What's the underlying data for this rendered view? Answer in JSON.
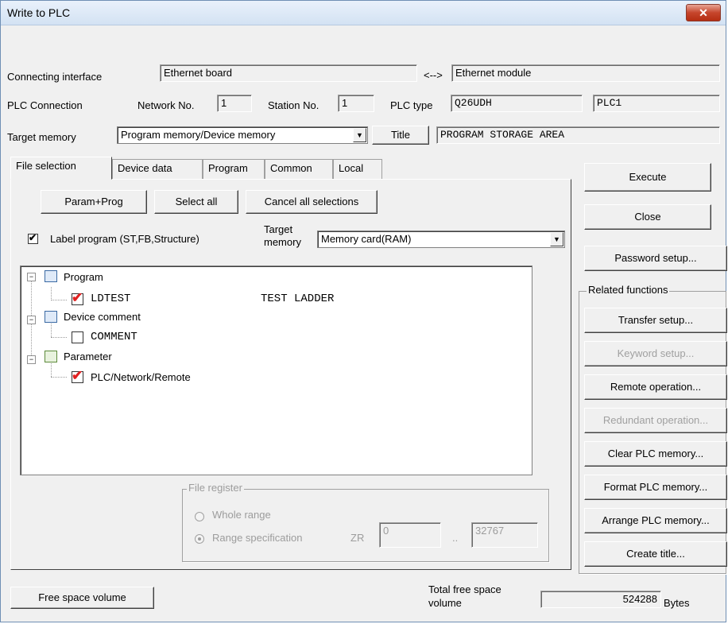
{
  "window": {
    "title": "Write to PLC",
    "close_label": "✕"
  },
  "connection": {
    "interface_label": "Connecting interface",
    "interface_value": "Ethernet board",
    "arrow": "<-->",
    "module_value": "Ethernet module",
    "plc_connection_label": "PLC Connection",
    "network_label": "Network No.",
    "network_value": "1",
    "station_label": "Station No.",
    "station_value": "1",
    "plc_type_label": "PLC type",
    "plc_type_value": "Q26UDH",
    "plc_name_value": "PLC1"
  },
  "target": {
    "label": "Target memory",
    "value": "Program memory/Device memory",
    "title_button": "Title",
    "title_value": "PROGRAM STORAGE AREA"
  },
  "tabs": [
    {
      "label": "File selection"
    },
    {
      "label": "Device data"
    },
    {
      "label": "Program"
    },
    {
      "label": "Common"
    },
    {
      "label": "Local"
    }
  ],
  "file_selection": {
    "param_prog": "Param+Prog",
    "select_all": "Select all",
    "cancel_all": "Cancel all selections",
    "label_program": "Label program (ST,FB,Structure)",
    "target_memory_label_1": "Target",
    "target_memory_label_2": "memory",
    "target_memory_value": "Memory card(RAM)",
    "tree": {
      "program": "Program",
      "ldtest": "LDTEST",
      "ldtest_title": "TEST LADDER",
      "device_comment": "Device comment",
      "comment": "COMMENT",
      "parameter": "Parameter",
      "plc_network": "PLC/Network/Remote"
    },
    "file_register": {
      "label": "File register",
      "whole_range": "Whole range",
      "range_spec": "Range specification",
      "zr": "ZR",
      "from": "0",
      "sep": "..",
      "to": "32767"
    }
  },
  "right": {
    "execute": "Execute",
    "close": "Close",
    "password": "Password setup...",
    "related": "Related functions",
    "transfer": "Transfer setup...",
    "keyword": "Keyword setup...",
    "remote": "Remote operation...",
    "redundant": "Redundant operation...",
    "clear": "Clear PLC memory...",
    "format": "Format PLC memory...",
    "arrange": "Arrange PLC memory...",
    "create_title": "Create title..."
  },
  "bottom": {
    "free_space_button": "Free space volume",
    "total_label_1": "Total free space",
    "total_label_2": "volume",
    "total_value": "524288",
    "unit": "Bytes"
  },
  "colors": {
    "check_red": "#e02020",
    "title_bar": "#dbe7f5"
  }
}
